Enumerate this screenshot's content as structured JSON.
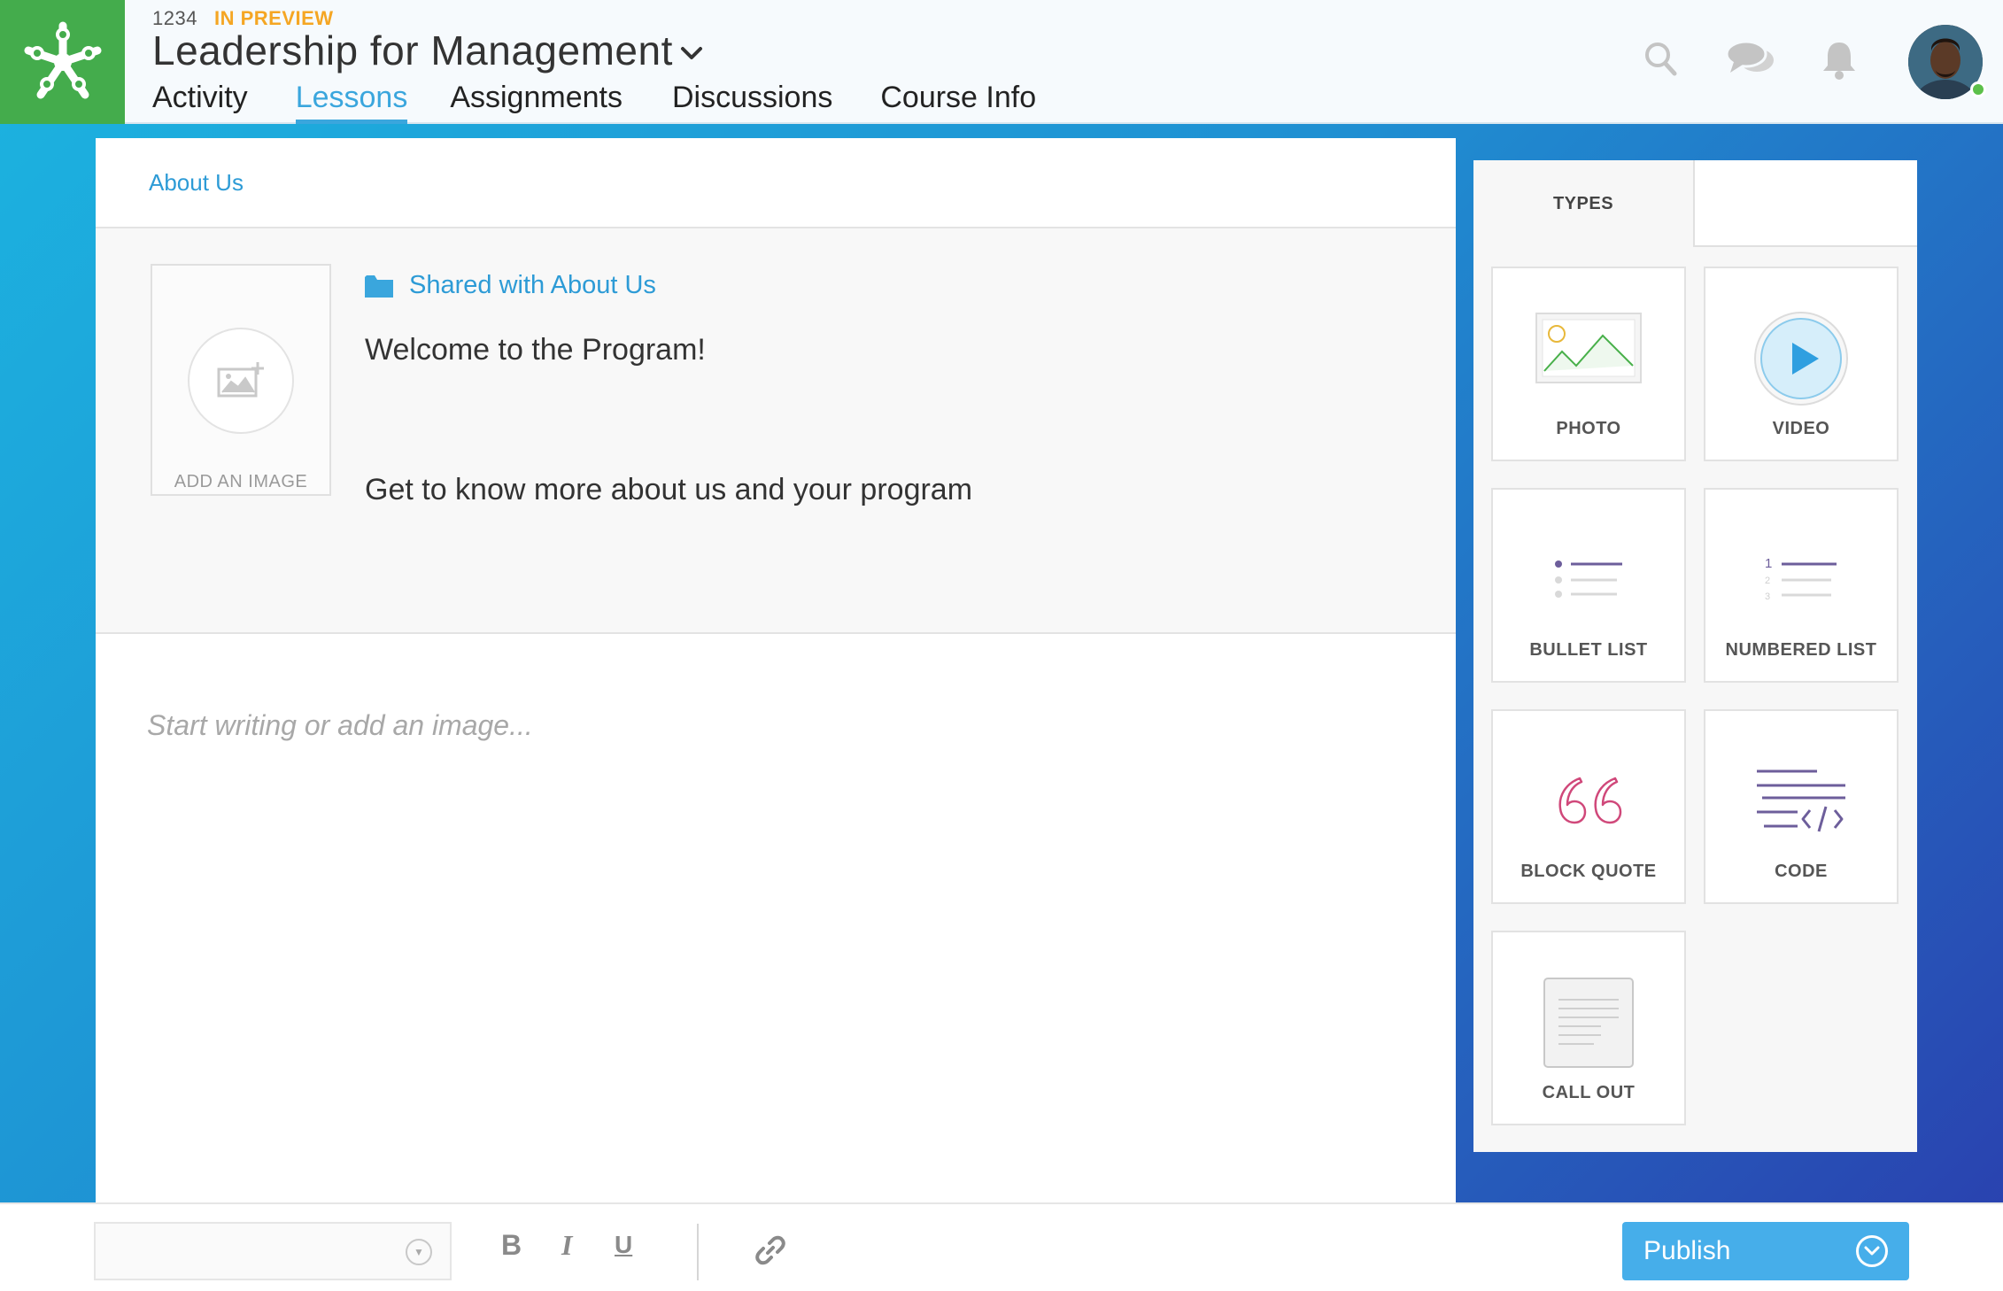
{
  "header": {
    "course_id": "1234",
    "status_badge": "IN PREVIEW",
    "course_title": "Leadership for Management",
    "nav_tabs": [
      {
        "label": "Activity",
        "active": false
      },
      {
        "label": "Lessons",
        "active": true
      },
      {
        "label": "Assignments",
        "active": false
      },
      {
        "label": "Discussions",
        "active": false
      },
      {
        "label": "Course Info",
        "active": false
      }
    ],
    "icons": [
      "search-icon",
      "chat-icon",
      "bell-icon"
    ],
    "user_online": true
  },
  "editor": {
    "breadcrumb": "About Us",
    "image_placeholder_label": "ADD AN IMAGE",
    "shared_label": "Shared with About Us",
    "intro_title": "Welcome to the Program!",
    "intro_subtitle": "Get to know more about us and your program",
    "body_placeholder": "Start writing or add an image..."
  },
  "sidebar": {
    "tabs": [
      {
        "label": "TYPES",
        "active": true
      },
      {
        "label": "",
        "active": false
      }
    ],
    "tiles": [
      {
        "label": "PHOTO",
        "icon": "photo-icon"
      },
      {
        "label": "VIDEO",
        "icon": "video-icon"
      },
      {
        "label": "BULLET LIST",
        "icon": "bullet-list-icon"
      },
      {
        "label": "NUMBERED LIST",
        "icon": "numbered-list-icon"
      },
      {
        "label": "BLOCK QUOTE",
        "icon": "block-quote-icon"
      },
      {
        "label": "CODE",
        "icon": "code-icon"
      },
      {
        "label": "CALL OUT",
        "icon": "call-out-icon"
      }
    ]
  },
  "toolbar": {
    "style_select_value": "",
    "bold_label": "B",
    "italic_label": "I",
    "underline_label": "U",
    "publish_label": "Publish"
  },
  "colors": {
    "brand_green": "#44ac4c",
    "accent_blue": "#3aa6dd",
    "preview_orange": "#f5a623",
    "publish_blue": "#46aeea",
    "quote_pink": "#d0487a",
    "list_purple": "#6d5e9b"
  }
}
